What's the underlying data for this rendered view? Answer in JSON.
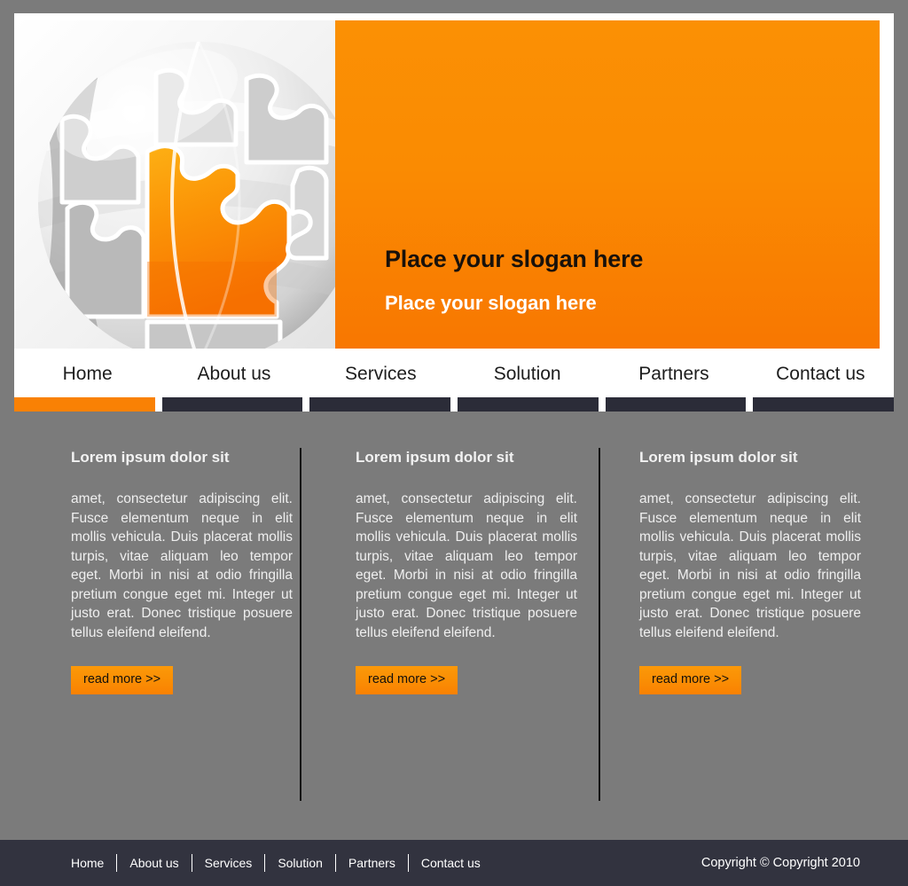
{
  "theme": {
    "accent_orange": "#f98104",
    "dark_navy": "#2b2c38",
    "footer_navy": "#32333f",
    "body_gray": "#7b7b7b",
    "frame_white": "#ffffff"
  },
  "hero": {
    "graphic": "globe-puzzle-icon",
    "slogan_primary": "Place your slogan here",
    "slogan_secondary": "Place your slogan here"
  },
  "nav": {
    "items": [
      {
        "label": "Home",
        "active": true
      },
      {
        "label": "About us",
        "active": false
      },
      {
        "label": "Services",
        "active": false
      },
      {
        "label": "Solution",
        "active": false
      },
      {
        "label": "Partners",
        "active": false
      },
      {
        "label": "Contact us",
        "active": false
      }
    ]
  },
  "content": {
    "columns": [
      {
        "heading": "Lorem ipsum dolor sit",
        "body": "amet, consectetur adipiscing elit. Fusce elementum neque in elit mollis vehicula. Duis placerat mollis turpis, vitae aliquam leo tempor eget. Morbi in nisi at odio fringilla pretium congue eget mi. Integer ut justo erat. Donec tristique posuere tellus eleifend eleifend.",
        "cta": "read more >>"
      },
      {
        "heading": "Lorem ipsum dolor sit",
        "body": "amet, consectetur adipiscing elit. Fusce elementum neque in elit mollis vehicula. Duis placerat mollis turpis, vitae aliquam leo tempor eget. Morbi in nisi at odio fringilla pretium congue eget mi. Integer ut justo erat. Donec tristique posuere tellus eleifend eleifend.",
        "cta": "read more >>"
      },
      {
        "heading": "Lorem ipsum dolor sit",
        "body": "amet, consectetur adipiscing elit. Fusce elementum neque in elit mollis vehicula. Duis placerat mollis turpis, vitae aliquam leo tempor eget. Morbi in nisi at odio fringilla pretium congue eget mi. Integer ut justo erat. Donec tristique posuere tellus eleifend eleifend.",
        "cta": "read more >>"
      }
    ]
  },
  "footer": {
    "links": [
      {
        "label": "Home"
      },
      {
        "label": "About us"
      },
      {
        "label": "Services"
      },
      {
        "label": "Solution"
      },
      {
        "label": "Partners"
      },
      {
        "label": "Contact us"
      }
    ],
    "copyright": "Copyright © Copyright  2010"
  }
}
